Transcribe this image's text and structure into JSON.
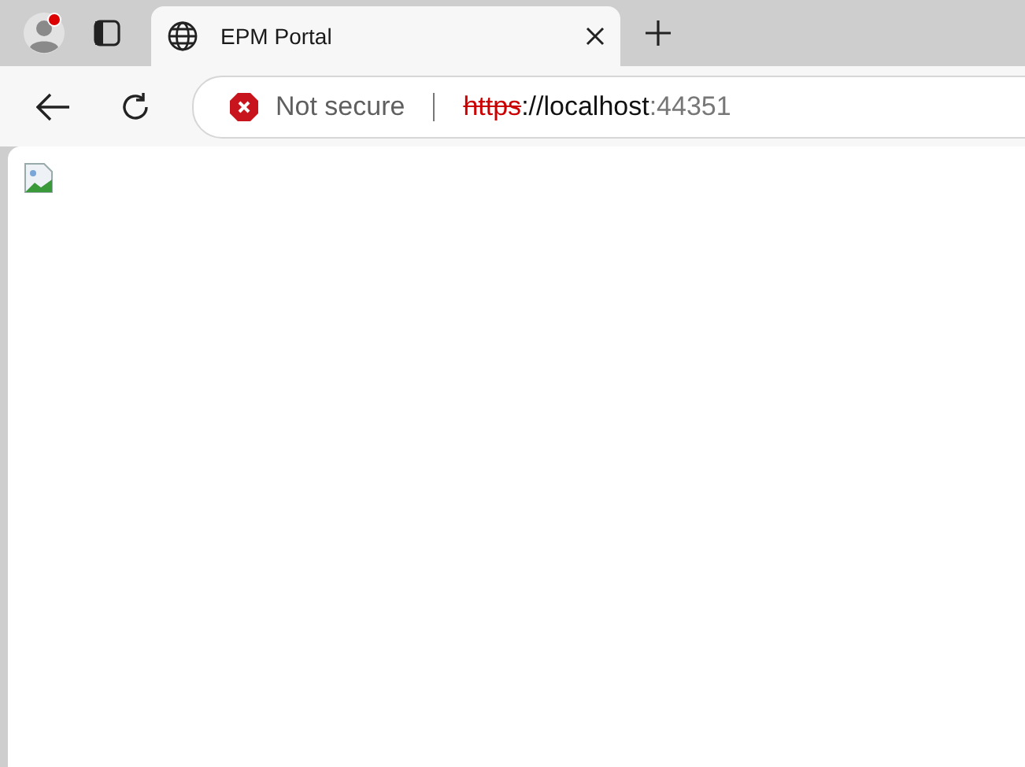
{
  "tabs": [
    {
      "title": "EPM Portal",
      "selected": true
    }
  ],
  "profile": {
    "notification": true
  },
  "address_bar": {
    "security": "Not secure",
    "url": [
      {
        "kind": "scheme",
        "text": "https"
      },
      {
        "kind": "host",
        "text": "://localhost"
      },
      {
        "kind": "port",
        "text": ":44351"
      }
    ]
  }
}
